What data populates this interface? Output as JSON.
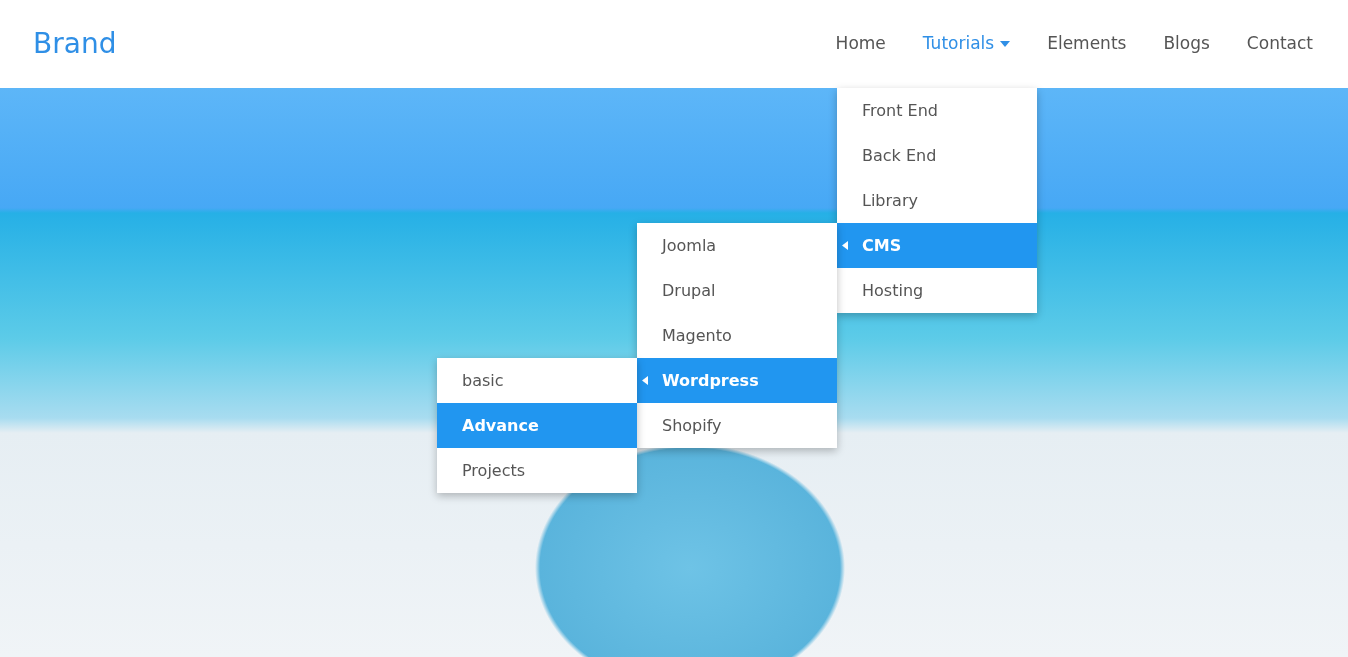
{
  "brand": "Brand",
  "nav": [
    {
      "label": "Home",
      "selected": false
    },
    {
      "label": "Tutorials",
      "selected": true,
      "menu": [
        {
          "label": "Front End",
          "selected": false
        },
        {
          "label": "Back End",
          "selected": false
        },
        {
          "label": "Library",
          "selected": false
        },
        {
          "label": "CMS",
          "selected": true,
          "children": [
            {
              "label": "Joomla",
              "selected": false
            },
            {
              "label": "Drupal",
              "selected": false
            },
            {
              "label": "Magento",
              "selected": false
            },
            {
              "label": "Wordpress",
              "selected": true,
              "children": [
                {
                  "label": "basic",
                  "selected": false
                },
                {
                  "label": "Advance",
                  "selected": true
                },
                {
                  "label": "Projects",
                  "selected": false
                }
              ]
            },
            {
              "label": "Shopify",
              "selected": false
            }
          ]
        },
        {
          "label": "Hosting",
          "selected": false
        }
      ]
    },
    {
      "label": "Elements",
      "selected": false
    },
    {
      "label": "Blogs",
      "selected": false
    },
    {
      "label": "Contact",
      "selected": false
    }
  ]
}
